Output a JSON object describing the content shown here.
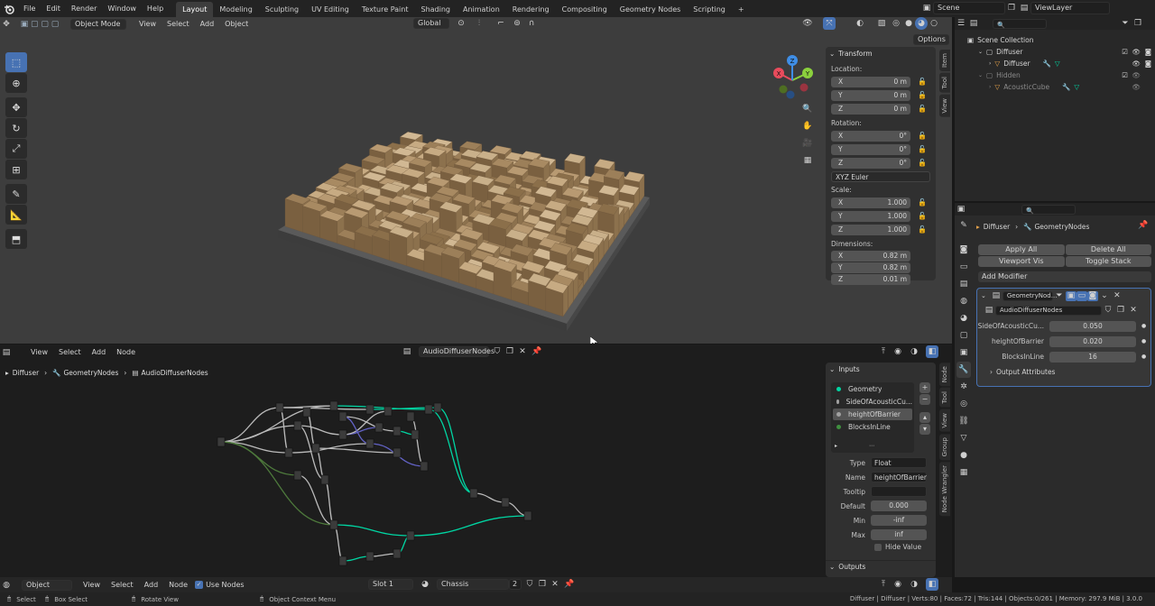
{
  "topbar": {
    "menus": [
      "File",
      "Edit",
      "Render",
      "Window",
      "Help"
    ],
    "workspaces": [
      "Layout",
      "Modeling",
      "Sculpting",
      "UV Editing",
      "Texture Paint",
      "Shading",
      "Animation",
      "Rendering",
      "Compositing",
      "Geometry Nodes",
      "Scripting"
    ],
    "active_workspace": "Layout",
    "add_tab": "+",
    "scene": "Scene",
    "view_layer": "ViewLayer"
  },
  "viewport": {
    "mode": "Object Mode",
    "menus": [
      "View",
      "Select",
      "Add",
      "Object"
    ],
    "orientation": "Global",
    "options": "Options",
    "axis_x": "X",
    "axis_y": "Y",
    "axis_z": "Z",
    "n_panel": {
      "tabs": [
        "Item",
        "Tool",
        "View"
      ],
      "section": "Transform",
      "location_label": "Location:",
      "location": [
        {
          "axis": "X",
          "value": "0 m"
        },
        {
          "axis": "Y",
          "value": "0 m"
        },
        {
          "axis": "Z",
          "value": "0 m"
        }
      ],
      "rotation_label": "Rotation:",
      "rotation": [
        {
          "axis": "X",
          "value": "0°"
        },
        {
          "axis": "Y",
          "value": "0°"
        },
        {
          "axis": "Z",
          "value": "0°"
        }
      ],
      "rotation_mode": "XYZ Euler",
      "scale_label": "Scale:",
      "scale": [
        {
          "axis": "X",
          "value": "1.000"
        },
        {
          "axis": "Y",
          "value": "1.000"
        },
        {
          "axis": "Z",
          "value": "1.000"
        }
      ],
      "dimensions_label": "Dimensions:",
      "dimensions": [
        {
          "axis": "X",
          "value": "0.82 m"
        },
        {
          "axis": "Y",
          "value": "0.82 m"
        },
        {
          "axis": "Z",
          "value": "0.01 m"
        }
      ]
    }
  },
  "node_editor": {
    "menus": [
      "View",
      "Select",
      "Add",
      "Node"
    ],
    "node_tree": "AudioDiffuserNodes",
    "breadcrumb": [
      "Diffuser",
      "GeometryNodes",
      "AudioDiffuserNodes"
    ],
    "side": {
      "tabs": [
        "Node",
        "Tool",
        "View",
        "Group",
        "Node Wrangler"
      ],
      "inputs_title": "Inputs",
      "inputs": [
        {
          "name": "Geometry",
          "color": "#00d6a3"
        },
        {
          "name": "SideOfAcousticCu...",
          "color": "#a1a1a1"
        },
        {
          "name": "heightOfBarrier",
          "color": "#a1a1a1"
        },
        {
          "name": "BlocksInLine",
          "color": "#3f8f3f"
        }
      ],
      "selected_index": 2,
      "type_label": "Type",
      "type_value": "Float",
      "name_label": "Name",
      "name_value": "heightOfBarrier",
      "tooltip_label": "Tooltip",
      "tooltip_value": "",
      "default_label": "Default",
      "default_value": "0.000",
      "min_label": "Min",
      "min_value": "-inf",
      "max_label": "Max",
      "max_value": "inf",
      "hide_value": "Hide Value",
      "outputs_title": "Outputs"
    }
  },
  "outliner": {
    "root": "Scene Collection",
    "items": [
      {
        "name": "Diffuser",
        "level": 1
      },
      {
        "name": "Diffuser",
        "level": 2
      },
      {
        "name": "Hidden",
        "level": 1
      },
      {
        "name": "AcousticCube",
        "level": 2
      }
    ]
  },
  "properties": {
    "breadcrumb": [
      "Diffuser",
      "GeometryNodes"
    ],
    "apply_all": "Apply All",
    "delete_all": "Delete All",
    "viewport_vis": "Viewport Vis",
    "toggle_stack": "Toggle Stack",
    "add_modifier": "Add Modifier",
    "modifier_name": "GeometryNod...",
    "node_group": "AudioDiffuserNodes",
    "params": [
      {
        "label": "SideOfAcousticCu...",
        "value": "0.050"
      },
      {
        "label": "heightOfBarrier",
        "value": "0.020"
      },
      {
        "label": "BlocksInLine",
        "value": "16"
      }
    ],
    "output_attributes": "Output Attributes"
  },
  "bottom_header": {
    "mode": "Object",
    "menus": [
      "View",
      "Select",
      "Add",
      "Node"
    ],
    "use_nodes": "Use Nodes",
    "slot": "Slot 1",
    "material": "Chassis",
    "users": "2"
  },
  "statusbar": {
    "hints": [
      "Select",
      "Box Select",
      "Rotate View",
      "Object Context Menu"
    ],
    "stats": "Diffuser | Diffuser | Verts:80 | Faces:72 | Tris:144 | Objects:0/261 | Memory: 297.9 MiB | 3.0.0"
  },
  "colors": {
    "accent": "#4772b3",
    "geometry_link": "#00d6a3",
    "float_link": "#a1a1a1",
    "int_link": "#3f8f3f",
    "vector_link": "#6363c7"
  }
}
